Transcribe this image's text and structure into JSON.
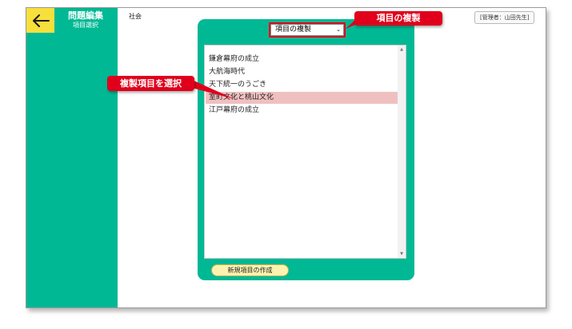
{
  "header": {
    "back_icon": "arrow-left-icon",
    "title": "問題編集",
    "subtitle": "項目選択",
    "subject": "社会",
    "admin": "[管理者：山田先生]"
  },
  "panel": {
    "dropdown_selected": "項目の複製",
    "items": [
      {
        "label": "鎌倉幕府の成立",
        "selected": false
      },
      {
        "label": "大航海時代",
        "selected": false
      },
      {
        "label": "天下統一のうごき",
        "selected": false
      },
      {
        "label": "室町文化と桃山文化",
        "selected": true
      },
      {
        "label": "江戸幕府の成立",
        "selected": false
      }
    ],
    "create_button": "新規項目の作成"
  },
  "annotations": {
    "copy_callout": "項目の複製",
    "select_callout": "複製項目を選択",
    "accent_color": "#e0001b"
  },
  "colors": {
    "brand": "#00b894",
    "back_button": "#f7df3c",
    "selected_row": "#f0c0c0",
    "create_button": "#fdf3b0"
  }
}
